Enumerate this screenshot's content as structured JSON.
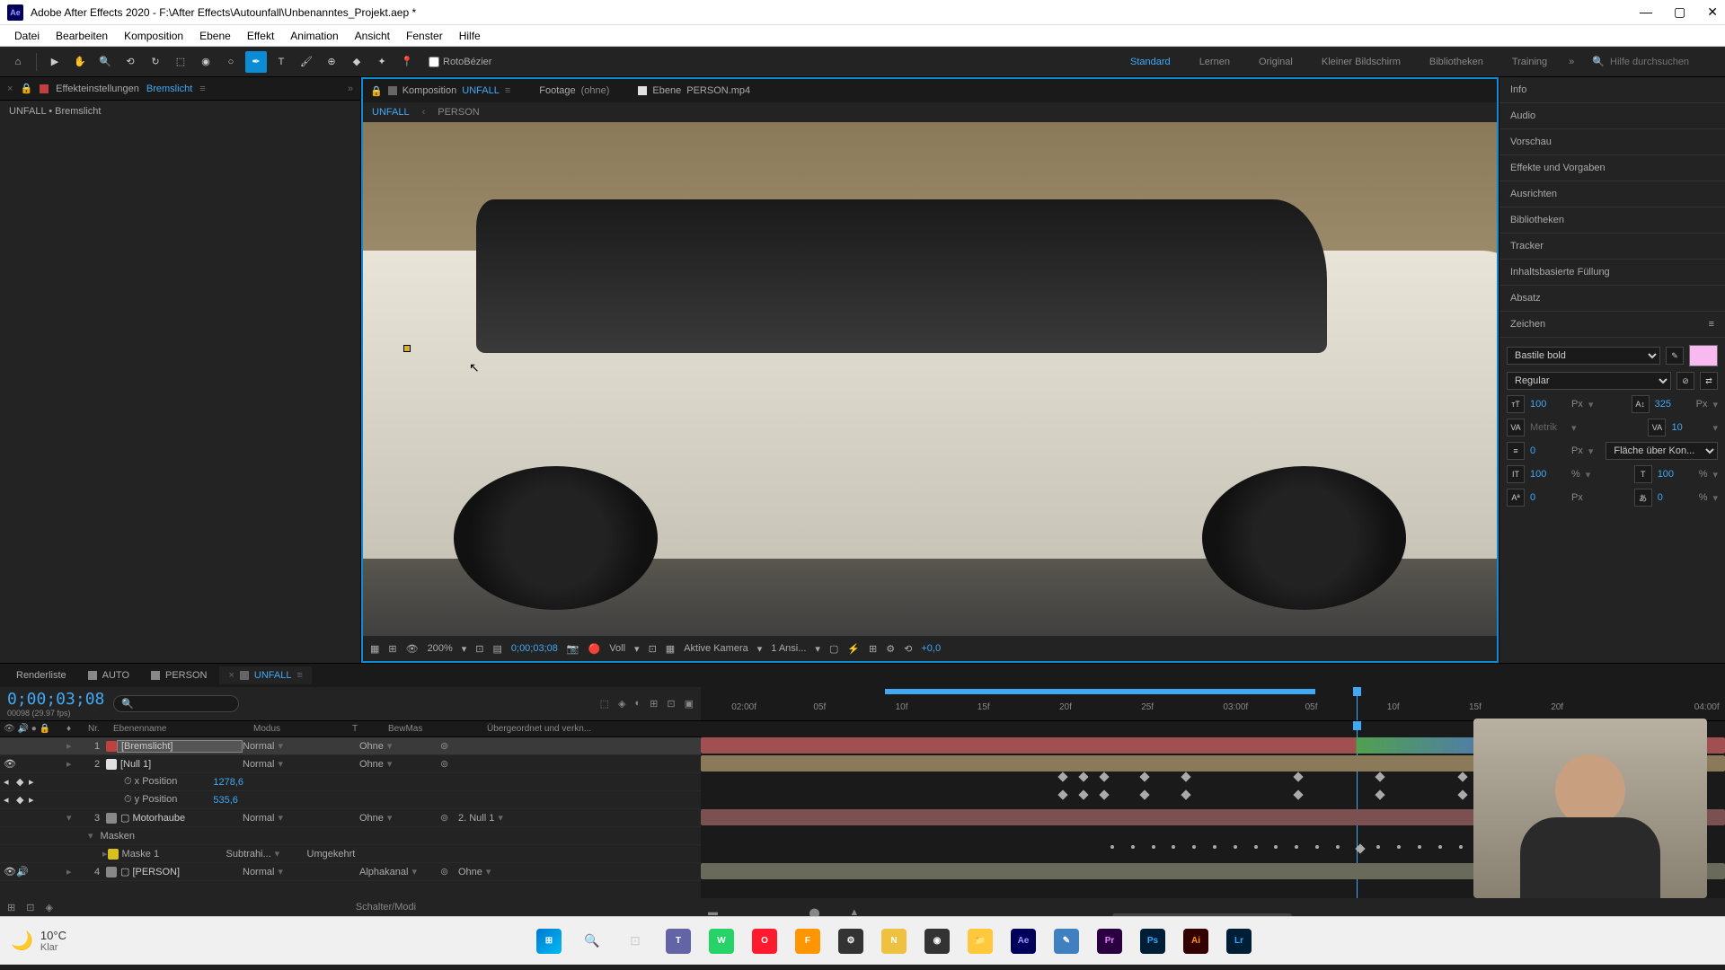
{
  "title": "Adobe After Effects 2020 - F:\\After Effects\\Autounfall\\Unbenanntes_Projekt.aep *",
  "menu": [
    "Datei",
    "Bearbeiten",
    "Komposition",
    "Ebene",
    "Effekt",
    "Animation",
    "Ansicht",
    "Fenster",
    "Hilfe"
  ],
  "toolbar": {
    "rotobezier": "RotoBézier",
    "workspaces": [
      "Standard",
      "Lernen",
      "Original",
      "Kleiner Bildschirm",
      "Bibliotheken",
      "Training"
    ],
    "active_workspace": "Standard",
    "search_placeholder": "Hilfe durchsuchen"
  },
  "left_panel": {
    "tab1": "Effekteinstellungen",
    "tab1_target": "Bremslicht",
    "breadcrumb": "UNFALL • Bremslicht"
  },
  "center": {
    "tab_comp": "Komposition",
    "tab_comp_name": "UNFALL",
    "tab_footage": "Footage",
    "tab_footage_val": "(ohne)",
    "tab_layer": "Ebene",
    "tab_layer_val": "PERSON.mp4",
    "mini_tabs": [
      "UNFALL",
      "PERSON"
    ],
    "footer": {
      "zoom": "200%",
      "timecode": "0;00;03;08",
      "res": "Voll",
      "camera": "Aktive Kamera",
      "views": "1 Ansi...",
      "exposure": "+0,0"
    }
  },
  "right_panel": {
    "items": [
      "Info",
      "Audio",
      "Vorschau",
      "Effekte und Vorgaben",
      "Ausrichten",
      "Bibliotheken",
      "Tracker",
      "Inhaltsbasierte Füllung",
      "Absatz",
      "Zeichen"
    ],
    "char": {
      "font": "Bastile bold",
      "style": "Regular",
      "size": "100",
      "size_unit": "Px",
      "leading": "325",
      "leading_unit": "Px",
      "kerning": "Metrik",
      "tracking": "10",
      "stroke": "0",
      "stroke_unit": "Px",
      "stroke_mode": "Fläche über Kon...",
      "vscale": "100",
      "vscale_unit": "%",
      "hscale": "100",
      "hscale_unit": "%",
      "baseline": "0",
      "baseline_unit": "Px",
      "tsume": "0",
      "tsume_unit": "%"
    }
  },
  "timeline": {
    "tabs": [
      "Renderliste",
      "AUTO",
      "PERSON",
      "UNFALL"
    ],
    "active_tab": "UNFALL",
    "timecode": "0;00;03;08",
    "timecode_sub": "00098 (29.97 fps)",
    "cols": {
      "num": "Nr.",
      "name": "Ebenenname",
      "mode": "Modus",
      "t": "T",
      "trkmat": "BewMas",
      "parent": "Übergeordnet und verkn..."
    },
    "ruler": [
      "02:00f",
      "05f",
      "10f",
      "15f",
      "20f",
      "25f",
      "03:00f",
      "05f",
      "10f",
      "15f",
      "20f",
      "04:00f"
    ],
    "layers": [
      {
        "num": "1",
        "color": "#c04040",
        "name": "[Bremslicht]",
        "mode": "Normal",
        "trkmat": "Ohne",
        "parent": "",
        "selected": true
      },
      {
        "num": "2",
        "color": "#e0e0e0",
        "name": "[Null 1]",
        "mode": "Normal",
        "trkmat": "Ohne",
        "parent": ""
      },
      {
        "prop": "x Position",
        "val": "1278,6"
      },
      {
        "prop": "y Position",
        "val": "535,6"
      },
      {
        "num": "3",
        "color": "#888",
        "name": "Motorhaube",
        "mode": "Normal",
        "trkmat": "Ohne",
        "parent": "2. Null 1"
      },
      {
        "group": "Masken"
      },
      {
        "mask": "Maske 1",
        "mode": "Subtrahi...",
        "invert": "Umgekehrt",
        "color": "#d8c020"
      },
      {
        "num": "4",
        "color": "#888",
        "name": "[PERSON]",
        "mode": "Normal",
        "trkmat": "Alphakanal",
        "parent": "Ohne"
      }
    ],
    "switches_label": "Schalter/Modi"
  },
  "taskbar": {
    "temp": "10°C",
    "condition": "Klar"
  },
  "chart_data": null
}
